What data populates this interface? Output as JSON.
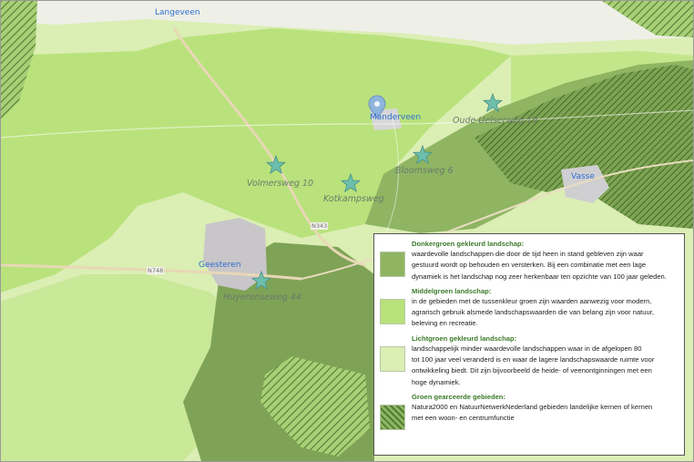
{
  "colors": {
    "dark_green": "#7fa356",
    "middle_green": "#b8e27a",
    "light_green": "#dbeeb4",
    "hatched": "#5d8a3a",
    "legend_title": "#3c7a2a",
    "pin_star": "#69bca5",
    "place_label": "#2f6fd0"
  },
  "map": {
    "places": [
      {
        "id": "langeveen",
        "label": "Langeveen"
      },
      {
        "id": "manderveen",
        "label": "Manderveen"
      },
      {
        "id": "vasse",
        "label": "Vasse"
      },
      {
        "id": "geesteren",
        "label": "Geesteren"
      }
    ],
    "roads": [
      {
        "id": "n343",
        "label": "N343"
      },
      {
        "id": "n748",
        "label": "N748"
      }
    ],
    "markers": [
      {
        "id": "oude-uelserweg",
        "label": "Oude Uelserweg 19",
        "icon": "star-marker"
      },
      {
        "id": "bloomsweg",
        "label": "Bloomsweg 6",
        "icon": "star-marker"
      },
      {
        "id": "volmersweg",
        "label": "Volmersweg 10",
        "icon": "star-marker"
      },
      {
        "id": "kotkampsweg",
        "label": "Kotkampsweg",
        "icon": "star-marker"
      },
      {
        "id": "huyerenseweg",
        "label": "Huyerenseweg 44",
        "icon": "star-marker"
      }
    ],
    "location_pin": {
      "icon": "location-pin"
    }
  },
  "legend": {
    "items": [
      {
        "title": "Donkergroen gekleurd landschap:",
        "lines": [
          "waardevolle landschappen die door de tijd heen in stand gebleven zijn waar",
          "gestuurd wordt op behouden en versterken. Bij een combinatie met een lage",
          "dynamiek is het landschap nog zeer herkenbaar  ten opzichte van 100 jaar geleden."
        ]
      },
      {
        "title": "Middelgroen landschap:",
        "lines": [
          "in de gebieden met de tussenkleur groen zijn waarden aanwezig voor modern,",
          "agrarisch gebruik alsmede landschapswaarden die van belang zijn voor natuur,",
          "beleving en recreatie."
        ]
      },
      {
        "title": "Lichtgroen gekleurd landschap:",
        "lines": [
          "landschappelijk minder waardevolle landschappen waar in de afgelopen 80",
          "tot 100 jaar veel veranderd is en waar de lagere landschapswaarde ruimte voor",
          "ontwikkeling biedt. Dit zijn bijvoorbeeld de heide- of veenontginningen met een",
          "hoge dynamiek."
        ]
      },
      {
        "title": "Groen gearceerde gebieden:",
        "lines": [
          "Natura2000 en NatuurNetwerkNederland gebieden landelijke kernen of kernen",
          "met een woon- en centrumfunctie"
        ]
      }
    ]
  }
}
